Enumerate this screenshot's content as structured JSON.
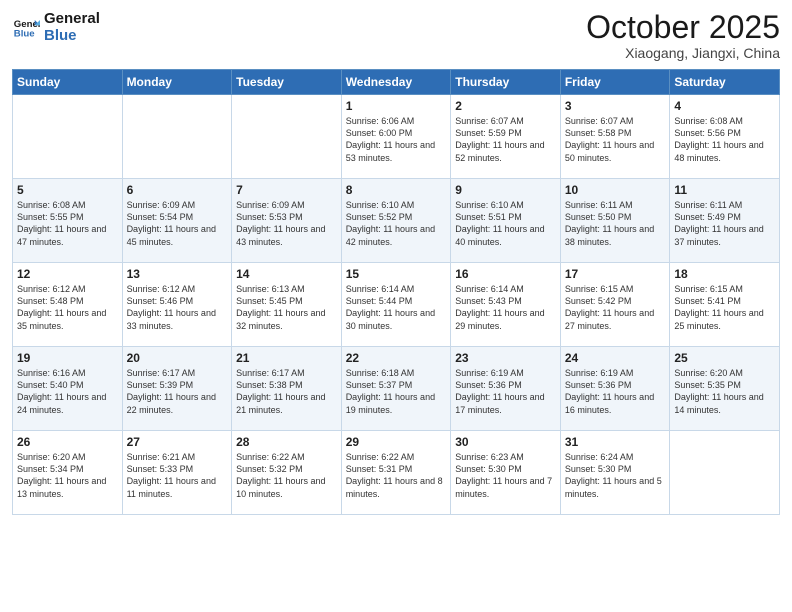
{
  "header": {
    "logo_line1": "General",
    "logo_line2": "Blue",
    "month": "October 2025",
    "location": "Xiaogang, Jiangxi, China"
  },
  "weekdays": [
    "Sunday",
    "Monday",
    "Tuesday",
    "Wednesday",
    "Thursday",
    "Friday",
    "Saturday"
  ],
  "weeks": [
    [
      {
        "day": "",
        "detail": ""
      },
      {
        "day": "",
        "detail": ""
      },
      {
        "day": "",
        "detail": ""
      },
      {
        "day": "1",
        "detail": "Sunrise: 6:06 AM\nSunset: 6:00 PM\nDaylight: 11 hours\nand 53 minutes."
      },
      {
        "day": "2",
        "detail": "Sunrise: 6:07 AM\nSunset: 5:59 PM\nDaylight: 11 hours\nand 52 minutes."
      },
      {
        "day": "3",
        "detail": "Sunrise: 6:07 AM\nSunset: 5:58 PM\nDaylight: 11 hours\nand 50 minutes."
      },
      {
        "day": "4",
        "detail": "Sunrise: 6:08 AM\nSunset: 5:56 PM\nDaylight: 11 hours\nand 48 minutes."
      }
    ],
    [
      {
        "day": "5",
        "detail": "Sunrise: 6:08 AM\nSunset: 5:55 PM\nDaylight: 11 hours\nand 47 minutes."
      },
      {
        "day": "6",
        "detail": "Sunrise: 6:09 AM\nSunset: 5:54 PM\nDaylight: 11 hours\nand 45 minutes."
      },
      {
        "day": "7",
        "detail": "Sunrise: 6:09 AM\nSunset: 5:53 PM\nDaylight: 11 hours\nand 43 minutes."
      },
      {
        "day": "8",
        "detail": "Sunrise: 6:10 AM\nSunset: 5:52 PM\nDaylight: 11 hours\nand 42 minutes."
      },
      {
        "day": "9",
        "detail": "Sunrise: 6:10 AM\nSunset: 5:51 PM\nDaylight: 11 hours\nand 40 minutes."
      },
      {
        "day": "10",
        "detail": "Sunrise: 6:11 AM\nSunset: 5:50 PM\nDaylight: 11 hours\nand 38 minutes."
      },
      {
        "day": "11",
        "detail": "Sunrise: 6:11 AM\nSunset: 5:49 PM\nDaylight: 11 hours\nand 37 minutes."
      }
    ],
    [
      {
        "day": "12",
        "detail": "Sunrise: 6:12 AM\nSunset: 5:48 PM\nDaylight: 11 hours\nand 35 minutes."
      },
      {
        "day": "13",
        "detail": "Sunrise: 6:12 AM\nSunset: 5:46 PM\nDaylight: 11 hours\nand 33 minutes."
      },
      {
        "day": "14",
        "detail": "Sunrise: 6:13 AM\nSunset: 5:45 PM\nDaylight: 11 hours\nand 32 minutes."
      },
      {
        "day": "15",
        "detail": "Sunrise: 6:14 AM\nSunset: 5:44 PM\nDaylight: 11 hours\nand 30 minutes."
      },
      {
        "day": "16",
        "detail": "Sunrise: 6:14 AM\nSunset: 5:43 PM\nDaylight: 11 hours\nand 29 minutes."
      },
      {
        "day": "17",
        "detail": "Sunrise: 6:15 AM\nSunset: 5:42 PM\nDaylight: 11 hours\nand 27 minutes."
      },
      {
        "day": "18",
        "detail": "Sunrise: 6:15 AM\nSunset: 5:41 PM\nDaylight: 11 hours\nand 25 minutes."
      }
    ],
    [
      {
        "day": "19",
        "detail": "Sunrise: 6:16 AM\nSunset: 5:40 PM\nDaylight: 11 hours\nand 24 minutes."
      },
      {
        "day": "20",
        "detail": "Sunrise: 6:17 AM\nSunset: 5:39 PM\nDaylight: 11 hours\nand 22 minutes."
      },
      {
        "day": "21",
        "detail": "Sunrise: 6:17 AM\nSunset: 5:38 PM\nDaylight: 11 hours\nand 21 minutes."
      },
      {
        "day": "22",
        "detail": "Sunrise: 6:18 AM\nSunset: 5:37 PM\nDaylight: 11 hours\nand 19 minutes."
      },
      {
        "day": "23",
        "detail": "Sunrise: 6:19 AM\nSunset: 5:36 PM\nDaylight: 11 hours\nand 17 minutes."
      },
      {
        "day": "24",
        "detail": "Sunrise: 6:19 AM\nSunset: 5:36 PM\nDaylight: 11 hours\nand 16 minutes."
      },
      {
        "day": "25",
        "detail": "Sunrise: 6:20 AM\nSunset: 5:35 PM\nDaylight: 11 hours\nand 14 minutes."
      }
    ],
    [
      {
        "day": "26",
        "detail": "Sunrise: 6:20 AM\nSunset: 5:34 PM\nDaylight: 11 hours\nand 13 minutes."
      },
      {
        "day": "27",
        "detail": "Sunrise: 6:21 AM\nSunset: 5:33 PM\nDaylight: 11 hours\nand 11 minutes."
      },
      {
        "day": "28",
        "detail": "Sunrise: 6:22 AM\nSunset: 5:32 PM\nDaylight: 11 hours\nand 10 minutes."
      },
      {
        "day": "29",
        "detail": "Sunrise: 6:22 AM\nSunset: 5:31 PM\nDaylight: 11 hours\nand 8 minutes."
      },
      {
        "day": "30",
        "detail": "Sunrise: 6:23 AM\nSunset: 5:30 PM\nDaylight: 11 hours\nand 7 minutes."
      },
      {
        "day": "31",
        "detail": "Sunrise: 6:24 AM\nSunset: 5:30 PM\nDaylight: 11 hours\nand 5 minutes."
      },
      {
        "day": "",
        "detail": ""
      }
    ]
  ]
}
